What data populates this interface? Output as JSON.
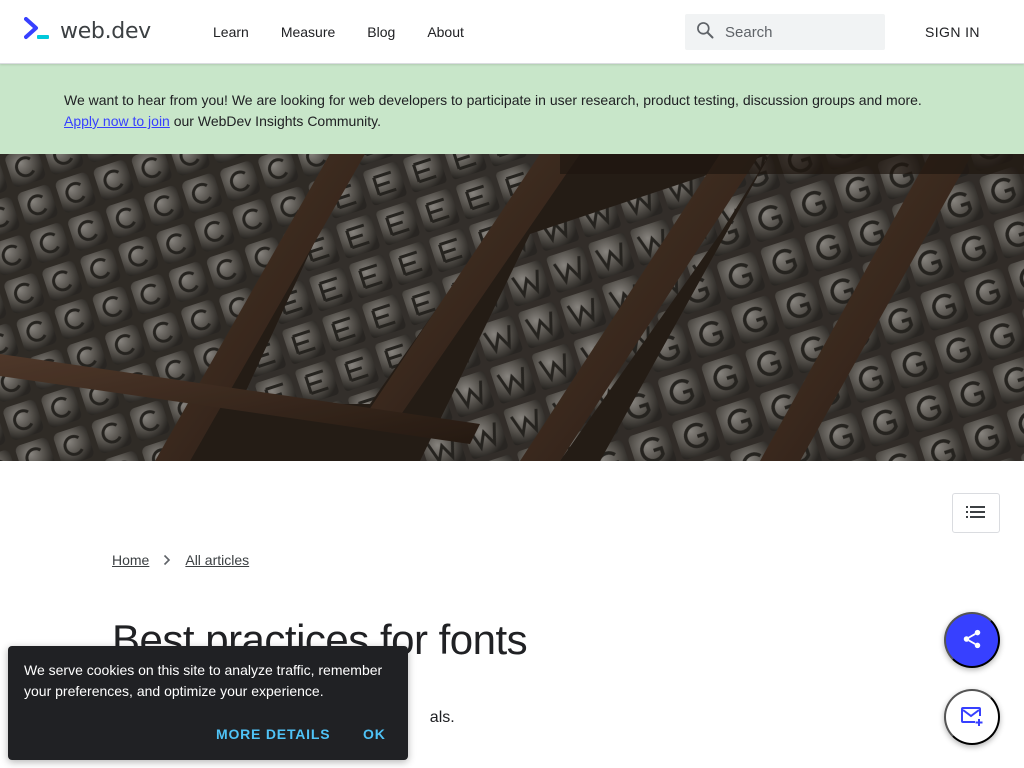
{
  "header": {
    "logo_text": "web.dev",
    "nav": [
      {
        "label": "Learn"
      },
      {
        "label": "Measure"
      },
      {
        "label": "Blog"
      },
      {
        "label": "About"
      }
    ],
    "search_placeholder": "Search",
    "signin_label": "SIGN IN"
  },
  "banner": {
    "text_before": "We want to hear from you! We are looking for web developers to participate in user research, product testing, discussion groups and more.",
    "link_label": "Apply now to join",
    "text_after": " our WebDev Insights Community."
  },
  "breadcrumb": [
    {
      "label": "Home"
    },
    {
      "label": "All articles"
    }
  ],
  "article": {
    "title": "Best practices for fonts",
    "subtitle_visible": "als."
  },
  "cookie": {
    "text": "We serve cookies on this site to analyze traffic, remember your preferences, and optimize your experience.",
    "more_label": "MORE DETAILS",
    "ok_label": "OK"
  },
  "colors": {
    "brand": "#3740ff",
    "banner_bg": "#c8e6c9",
    "cookie_bg": "#202124",
    "cookie_action": "#4fc3f7"
  },
  "icons": [
    "web-dev-logo-icon",
    "search-icon",
    "toc-list-icon",
    "chevron-right-icon",
    "share-icon",
    "mail-add-icon"
  ]
}
